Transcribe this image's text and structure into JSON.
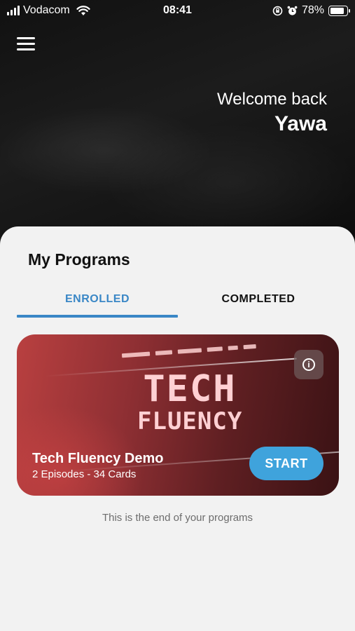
{
  "status_bar": {
    "carrier": "Vodacom",
    "time": "08:41",
    "battery": "78%",
    "battery_level": 0.78,
    "icons": [
      "signal-icon",
      "wifi-icon",
      "orientation-lock-icon",
      "alarm-icon",
      "battery-icon"
    ]
  },
  "header": {
    "menu_icon": "hamburger-menu-icon",
    "welcome_line": "Welcome back",
    "user_name": "Yawa"
  },
  "programs": {
    "title": "My Programs",
    "tabs": [
      {
        "label": "ENROLLED",
        "active": true
      },
      {
        "label": "COMPLETED",
        "active": false
      }
    ],
    "cards": [
      {
        "logo_line1": "TECH",
        "logo_line2": "FLUENCY",
        "title": "Tech Fluency Demo",
        "subtitle": "2 Episodes - 34 Cards",
        "action_label": "START",
        "info_icon": "info-icon"
      }
    ],
    "end_message": "This is the end of your programs"
  },
  "colors": {
    "accent": "#3a87c6",
    "start_button": "#3fa3dc",
    "sheet_background": "#f2f2f2",
    "header_background": "#111111",
    "card_red": "#b94040"
  }
}
